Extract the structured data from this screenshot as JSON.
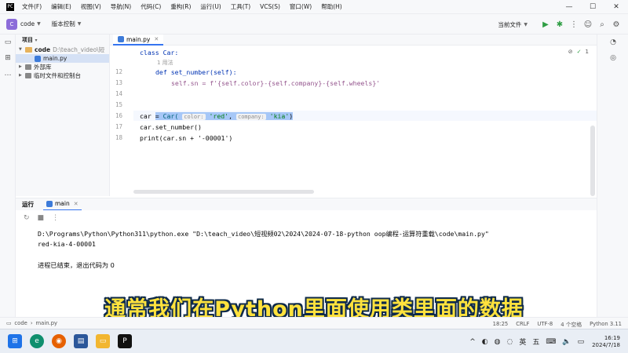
{
  "menu": {
    "items": [
      "文件(F)",
      "编辑(E)",
      "视图(V)",
      "导航(N)",
      "代码(C)",
      "重构(R)",
      "运行(U)",
      "工具(T)",
      "VCS(S)",
      "窗口(W)",
      "帮助(H)"
    ]
  },
  "toolbar": {
    "project_badge": "C",
    "project_name": "code",
    "vcs_label": "版本控制",
    "run_config": "当前文件"
  },
  "project_panel": {
    "title": "项目",
    "root_name": "code",
    "root_path": "D:\\teach_video\\短",
    "file": "main.py",
    "external_libs": "外部库",
    "scratches": "临时文件和控制台"
  },
  "editor": {
    "tab": "main.py",
    "usages_hint": "1 用法",
    "inspection_count": "1",
    "line_numbers": [
      "12",
      "13",
      "14",
      "15",
      "16",
      "17",
      "18"
    ],
    "lines": {
      "class_line": "class Car:",
      "def_line": "def set_number(self):",
      "body_line": "self.sn = f'{self.color}-{self.company}-{self.wheels}'",
      "assign_prefix": "car ",
      "assign_eq": "= ",
      "assign_call": "Car(",
      "hint_color": "color:",
      "arg_color": "'red'",
      "hint_company": "company:",
      "arg_company": "'kia'",
      "assign_close": ")",
      "call_line": "car.set_number()",
      "print_line": "print(car.sn + '-00001')"
    }
  },
  "run_panel": {
    "title": "运行",
    "tab": "main",
    "command": "D:\\Programs\\Python\\Python311\\python.exe \"D:\\teach_video\\短视频02\\2024\\2024-07-18-python oop编程-运算符重载\\code\\main.py\"",
    "output": "red-kia-4-00001",
    "exit": "进程已结束，退出代码为 0"
  },
  "subtitle": "通常我们在Python里面使用类里面的数据",
  "statusbar": {
    "project": "code",
    "file": "main.py",
    "position": "18:25",
    "line_ending": "CRLF",
    "encoding": "UTF-8",
    "indent": "4 个空格",
    "interpreter": "Python 3.11"
  },
  "taskbar": {
    "ime_en": "英",
    "ime_mode": "五",
    "time": "16:19",
    "date": "2024/7/18"
  }
}
